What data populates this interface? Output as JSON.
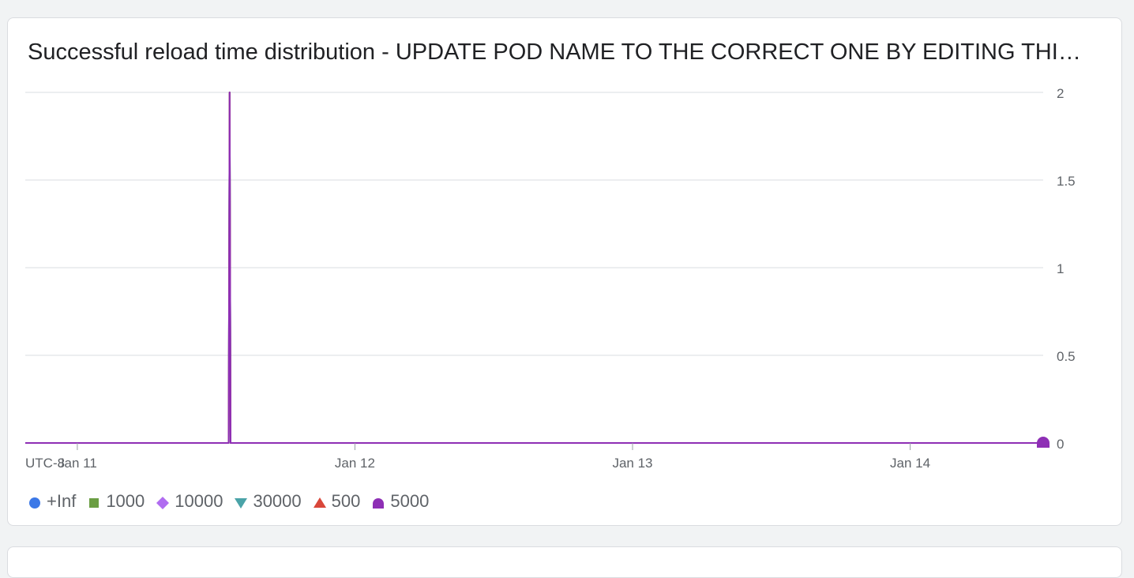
{
  "card": {
    "title": "Successful reload time distribution - UPDATE POD NAME TO THE CORRECT ONE BY EDITING THIS CHART"
  },
  "chart_data": {
    "type": "line",
    "timezone_label": "UTC-8",
    "x_ticks": [
      "Jan 11",
      "Jan 12",
      "Jan 13",
      "Jan 14"
    ],
    "y_ticks": [
      "0",
      "0.5",
      "1",
      "1.5",
      "2"
    ],
    "ylim": [
      0,
      2
    ],
    "xlim": [
      "Jan 10 19:30",
      "Jan 14 11:30"
    ],
    "grid": true,
    "legend_position": "bottom-left",
    "series": [
      {
        "name": "+Inf",
        "color": "#3b78e7",
        "marker": "circle",
        "points": [
          [
            "Jan 10 19:30",
            0
          ],
          [
            "Jan 11 13:05",
            0
          ],
          [
            "Jan 11 13:10",
            2
          ],
          [
            "Jan 11 13:15",
            0
          ],
          [
            "Jan 14 11:30",
            0
          ]
        ]
      },
      {
        "name": "1000",
        "color": "#6b9e43",
        "marker": "square",
        "points": [
          [
            "Jan 10 19:30",
            0
          ],
          [
            "Jan 11 13:05",
            0
          ],
          [
            "Jan 11 13:10",
            2
          ],
          [
            "Jan 11 13:15",
            0
          ],
          [
            "Jan 14 11:30",
            0
          ]
        ]
      },
      {
        "name": "10000",
        "color": "#b06cf0",
        "marker": "diamond",
        "points": [
          [
            "Jan 10 19:30",
            0
          ],
          [
            "Jan 11 13:05",
            0
          ],
          [
            "Jan 11 13:10",
            2
          ],
          [
            "Jan 11 13:15",
            0
          ],
          [
            "Jan 14 11:30",
            0
          ]
        ]
      },
      {
        "name": "30000",
        "color": "#4aa3a8",
        "marker": "triangle-down",
        "points": [
          [
            "Jan 10 19:30",
            0
          ],
          [
            "Jan 11 13:05",
            0
          ],
          [
            "Jan 11 13:10",
            2
          ],
          [
            "Jan 11 13:15",
            0
          ],
          [
            "Jan 14 11:30",
            0
          ]
        ]
      },
      {
        "name": "500",
        "color": "#d9473a",
        "marker": "triangle-up",
        "points": [
          [
            "Jan 10 19:30",
            0
          ],
          [
            "Jan 11 13:05",
            0
          ],
          [
            "Jan 11 13:10",
            2
          ],
          [
            "Jan 11 13:15",
            0
          ],
          [
            "Jan 14 11:30",
            0
          ]
        ]
      },
      {
        "name": "5000",
        "color": "#8e2fb5",
        "marker": "semicircle",
        "points": [
          [
            "Jan 10 19:30",
            0
          ],
          [
            "Jan 11 13:05",
            0
          ],
          [
            "Jan 11 13:10",
            2
          ],
          [
            "Jan 11 13:15",
            0
          ],
          [
            "Jan 14 11:30",
            0
          ]
        ]
      }
    ]
  }
}
